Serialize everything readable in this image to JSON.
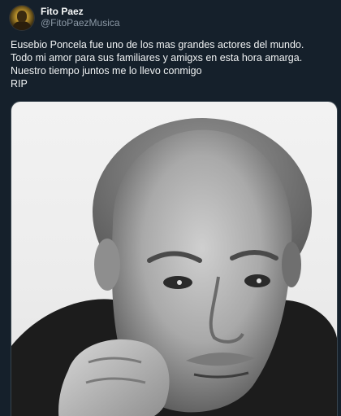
{
  "tweet": {
    "author": {
      "display_name": "Fito Paez",
      "handle": "@FitoPaezMusica"
    },
    "text_lines": [
      "Eusebio Poncela fue uno de los mas grandes actores del mundo.",
      "Todo mi amor para sus familiares y amigxs en esta hora amarga.",
      "Nuestro tiempo juntos me lo llevo conmigo",
      "RIP"
    ],
    "media": {
      "type": "photo",
      "content": "black and white portrait of an older man resting his chin on his fist"
    }
  },
  "colors": {
    "background": "#15202b",
    "text": "#f7f9f9",
    "handle": "#8b98a5",
    "border": "#38444d"
  }
}
